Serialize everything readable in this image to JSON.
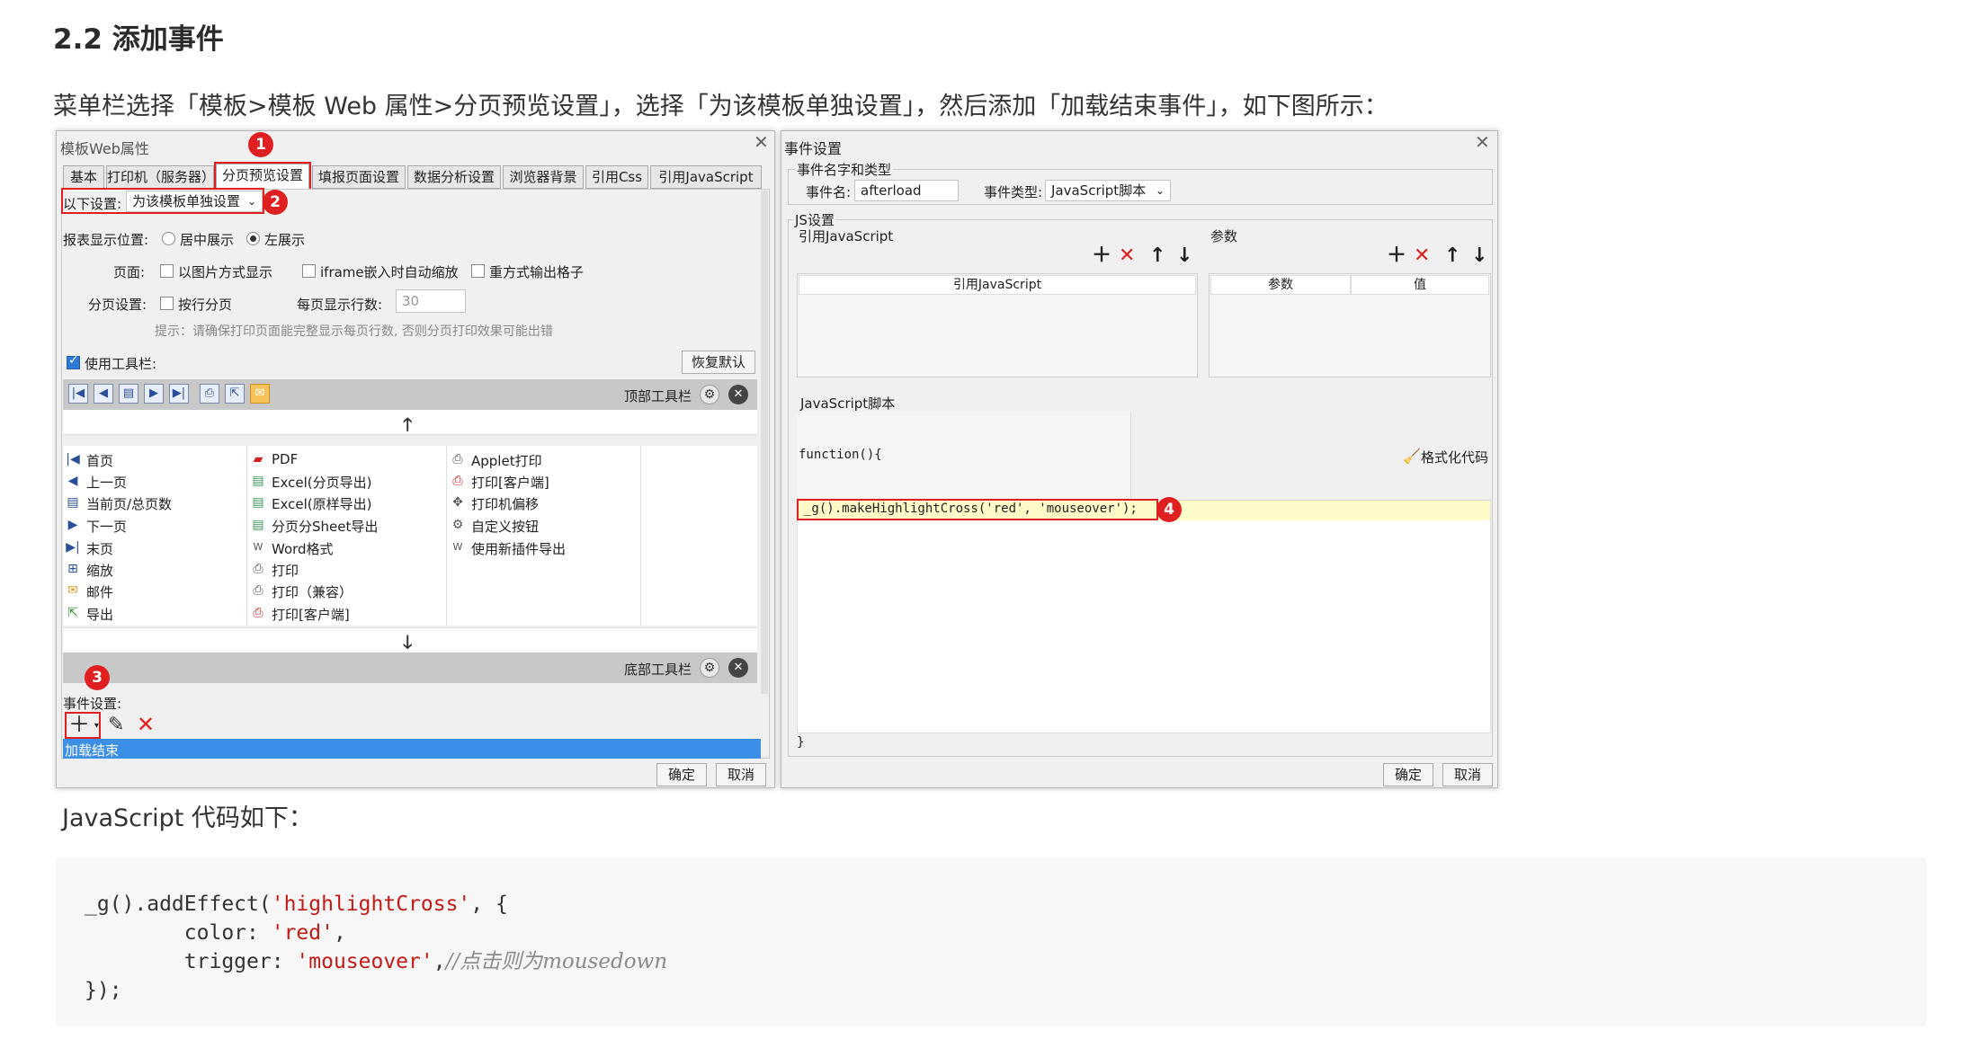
{
  "doc": {
    "heading": "2.2 添加事件",
    "instruction": "菜单栏选择「模板>模板 Web 属性>分页预览设置」，选择「为该模板单独设置」，然后添加「加载结束事件」，如下图所示：",
    "js_intro": "JavaScript 代码如下：",
    "code": {
      "l1a": "_g().addEffect(",
      "l1s": "'highlightCross'",
      "l1b": ", {",
      "l2a": "        color: ",
      "l2s": "'red'",
      "l2b": ",",
      "l3a": "        trigger: ",
      "l3s": "'mouseover'",
      "l3b": ",",
      "l3c": "//点击则为mousedown",
      "l4": "});"
    }
  },
  "web_dialog": {
    "title": "模板Web属性",
    "tabs": [
      "基本",
      "打印机（服务器）",
      "分页预览设置",
      "填报页面设置",
      "数据分析设置",
      "浏览器背景",
      "引用Css",
      "引用JavaScript"
    ],
    "setting_label": "以下设置:",
    "setting_value": "为该模板单独设置",
    "position_label": "报表显示位置:",
    "position_center": "居中展示",
    "position_left": "左展示",
    "page_label": "页面:",
    "page_opt1": "以图片方式显示",
    "page_opt2": "iframe嵌入时自动缩放",
    "page_opt3": "重方式输出格子",
    "paging_label": "分页设置:",
    "paging_opt": "按行分页",
    "rows_label": "每页显示行数:",
    "rows_value": "30",
    "hint": "提示：请确保打印页面能完整显示每页行数, 否则分页打印效果可能出错",
    "use_toolbar": "使用工具栏:",
    "restore_default": "恢复默认",
    "top_toolbar": "顶部工具栏",
    "bottom_toolbar": "底部工具栏",
    "col1": [
      "首页",
      "上一页",
      "当前页/总页数",
      "下一页",
      "末页",
      "缩放",
      "邮件",
      "导出"
    ],
    "col2": [
      "PDF",
      "Excel(分页导出)",
      "Excel(原样导出)",
      "分页分Sheet导出",
      "Word格式",
      "打印",
      "打印（兼容）",
      "打印[客户端]"
    ],
    "col3": [
      "Applet打印",
      "打印[客户端]",
      "打印机偏移",
      "自定义按钮",
      "使用新插件导出"
    ],
    "event_label": "事件设置:",
    "event_item": "加载结束",
    "ok": "确定",
    "cancel": "取消",
    "badges": [
      "1",
      "2",
      "3"
    ]
  },
  "event_dialog": {
    "title": "事件设置",
    "group_name_type": "事件名字和类型",
    "name_label": "事件名:",
    "name_value": "afterload",
    "type_label": "事件类型:",
    "type_value": "JavaScript脚本",
    "js_group": "JS设置",
    "ref_js_label": "引用JavaScript",
    "params_label": "参数",
    "ref_js_header": "引用JavaScript",
    "param_header": "参数",
    "value_header": "值",
    "script_label": "JavaScript脚本",
    "func_open": "function(){",
    "func_close": "}",
    "format_code": "格式化代码",
    "code_line": "_g().makeHighlightCross('red', 'mouseover');",
    "badge": "4",
    "ok": "确定",
    "cancel": "取消"
  },
  "colors": {
    "accent_red": "#e02020",
    "selection_blue": "#3c8fe6",
    "highlight_yellow": "#fffbc8"
  }
}
